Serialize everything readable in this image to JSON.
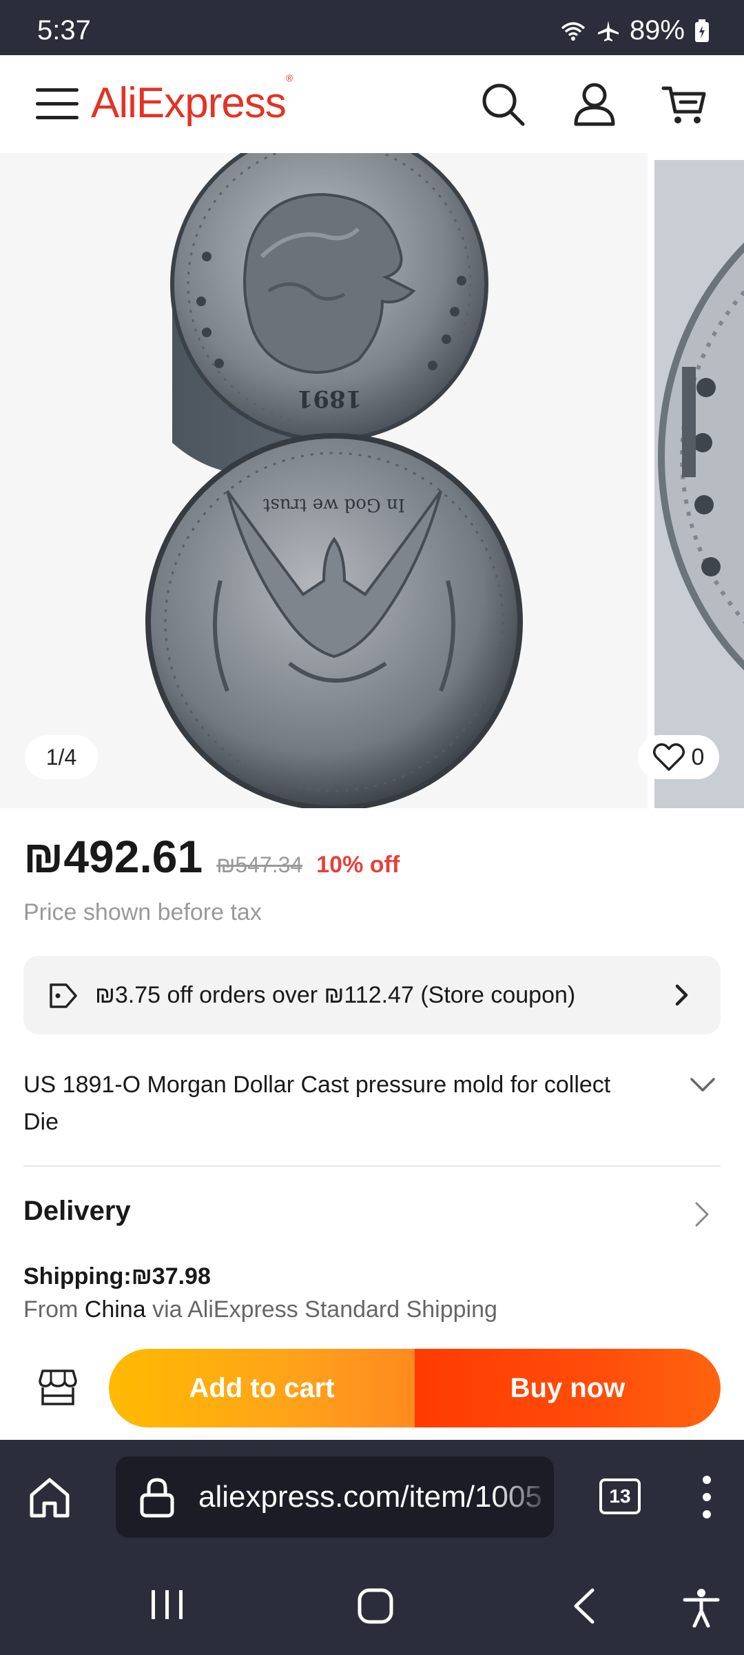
{
  "status": {
    "time": "5:37",
    "battery": "89%",
    "icons": [
      "wifi-icon",
      "airplane-icon",
      "battery-icon"
    ]
  },
  "header": {
    "logo": "AliExpress",
    "logo_mark": "®",
    "icons": [
      "menu-icon",
      "search-icon",
      "account-icon",
      "cart-icon"
    ]
  },
  "gallery": {
    "pager": "1/4",
    "favorites": "0",
    "coin_obverse_year": "1891",
    "coin_reverse_motto": "In God we trust"
  },
  "product": {
    "price": "₪492.61",
    "original_price": "₪547.34",
    "discount": "10% off",
    "tax_note": "Price shown before tax",
    "coupon": "₪3.75 off orders over ₪112.47 (Store coupon)",
    "title": "US 1891-O Morgan Dollar Cast pressure mold for collect Die"
  },
  "delivery": {
    "title": "Delivery",
    "shipping": "Shipping:₪37.98",
    "from_prefix": "From ",
    "from_country": "China",
    "from_suffix": " via AliExpress Standard Shipping"
  },
  "actions": {
    "add_to_cart": "Add to cart",
    "buy_now": "Buy now"
  },
  "browser": {
    "url": "aliexpress.com/item/1005",
    "tab_count": "13"
  },
  "colors": {
    "brand": "#e43225",
    "discount": "#e8403a",
    "add_to_cart": "#ffa31a",
    "buy_now": "#ff4d0a",
    "system_bar": "#2b2d3a"
  }
}
